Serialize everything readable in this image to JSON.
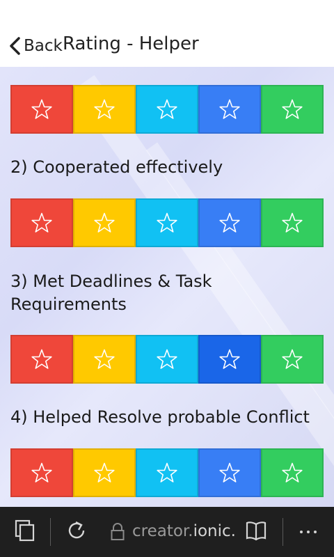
{
  "header": {
    "back_label": "Back",
    "title": "Rating - Helper"
  },
  "questions": [
    {
      "label": "2) Cooperated effectively"
    },
    {
      "label": "3) Met Deadlines & Task Requirements"
    },
    {
      "label": "4) Helped Resolve probable Conflict"
    }
  ],
  "rating_colors": [
    "#ef473a",
    "#ffc900",
    "#11c1f3",
    "#387ef5",
    "#33cd5f"
  ],
  "selected_color": "#1a66e8",
  "browser": {
    "url_prefix": "creator.",
    "url_domain": "ionic.io"
  }
}
